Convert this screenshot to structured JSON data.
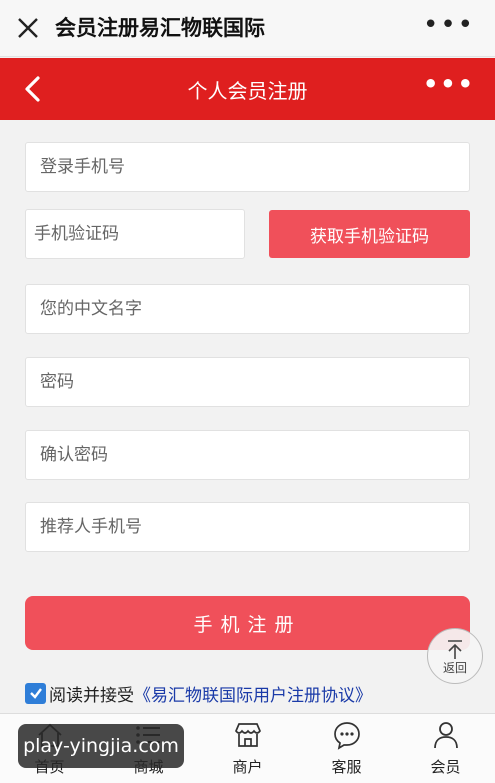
{
  "browser": {
    "title": "会员注册易汇物联国际",
    "more_label": "•••"
  },
  "header": {
    "title": "个人会员注册",
    "more_label": "•••"
  },
  "form": {
    "phone_placeholder": "登录手机号",
    "code_placeholder": "手机验证码",
    "get_code_label": "获取手机验证码",
    "name_placeholder": "您的中文名字",
    "password_placeholder": "密码",
    "confirm_password_placeholder": "确认密码",
    "referrer_placeholder": "推荐人手机号",
    "submit_label": "手机注册"
  },
  "agreement": {
    "checked": true,
    "prefix": "阅读并接受",
    "link": "《易汇物联国际用户注册协议》"
  },
  "back_to_top": {
    "label": "返回"
  },
  "nav": {
    "items": [
      {
        "label": "首页",
        "icon": "home-icon"
      },
      {
        "label": "商城",
        "icon": "list-icon"
      },
      {
        "label": "商户",
        "icon": "shop-icon"
      },
      {
        "label": "客服",
        "icon": "chat-icon"
      },
      {
        "label": "会员",
        "icon": "user-icon"
      }
    ]
  },
  "watermark": "play-yingjia.com",
  "colors": {
    "header": "#df1f1f",
    "button": "#f0505a",
    "link": "#1a3aa8",
    "checkbox": "#2f7ed8"
  }
}
